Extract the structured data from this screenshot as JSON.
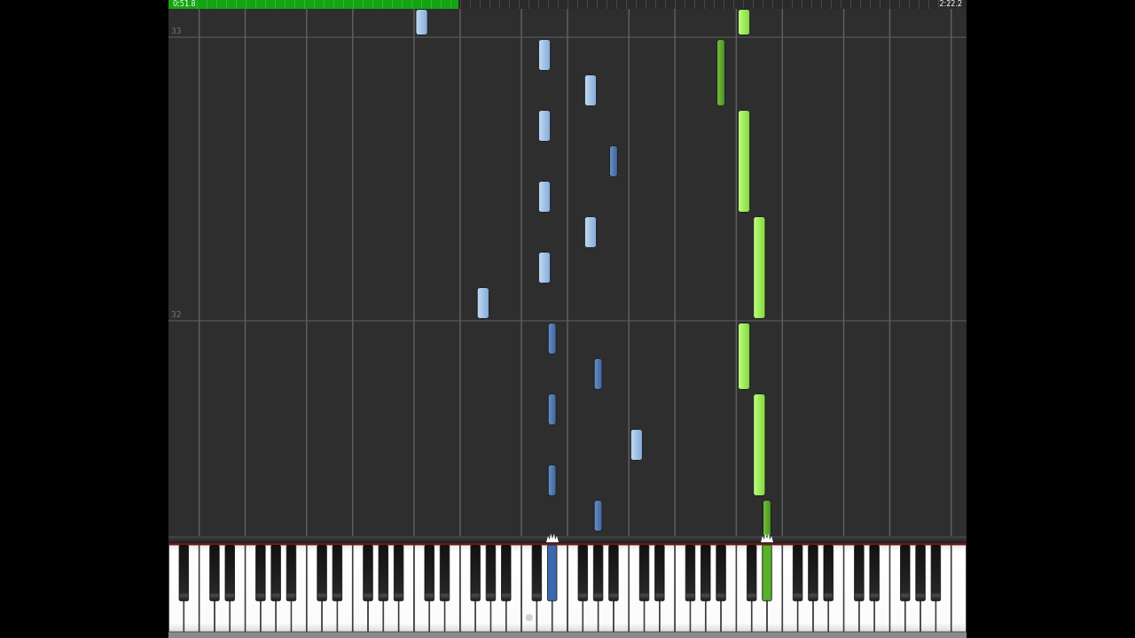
{
  "progress": {
    "elapsed": "0:51.8",
    "total": "2:22.2",
    "level": 0.363
  },
  "measures": [
    {
      "number": "33"
    },
    {
      "number": "32"
    }
  ],
  "keyboard": {
    "keys": [
      {
        "pressed": false
      },
      {
        "pressed": false
      },
      {
        "pressed": false
      },
      {
        "pressed": false
      },
      {
        "pressed": false
      },
      {
        "pressed": false
      },
      {
        "pressed": false
      },
      {
        "pressed": false
      },
      {
        "pressed": false
      },
      {
        "pressed": false
      },
      {
        "pressed": false
      },
      {
        "pressed": false
      },
      {
        "pressed": false
      },
      {
        "pressed": false
      },
      {
        "pressed": false
      },
      {
        "pressed": false
      },
      {
        "pressed": false
      },
      {
        "pressed": false
      },
      {
        "pressed": false
      },
      {
        "pressed": false
      },
      {
        "pressed": false
      },
      {
        "pressed": false
      },
      {
        "pressed": false
      },
      {
        "pressed": false
      },
      {
        "pressed": false
      },
      {
        "pressed": false
      },
      {
        "pressed": false
      },
      {
        "pressed": false
      },
      {
        "pressed": false
      },
      {
        "pressed": false
      },
      {
        "pressed": false
      },
      {
        "pressed": false
      },
      {
        "pressed": false
      },
      {
        "pressed": false
      },
      {
        "pressed": false
      },
      {
        "pressed": false
      },
      {
        "pressed": false
      },
      {
        "pressed": false
      },
      {
        "pressed": false
      },
      {
        "pressed": false
      },
      {
        "pressed": false
      },
      {
        "pressed": false
      },
      {
        "pressed": true,
        "color": "#3a6aad"
      },
      {
        "pressed": false
      },
      {
        "pressed": false
      },
      {
        "pressed": false
      },
      {
        "pressed": false
      },
      {
        "pressed": false
      },
      {
        "pressed": false
      },
      {
        "pressed": false
      },
      {
        "pressed": false
      },
      {
        "pressed": false
      },
      {
        "pressed": false
      },
      {
        "pressed": false
      },
      {
        "pressed": false
      },
      {
        "pressed": false
      },
      {
        "pressed": false
      },
      {
        "pressed": false
      },
      {
        "pressed": false
      },
      {
        "pressed": false
      },
      {
        "pressed": false
      },
      {
        "pressed": false
      },
      {
        "pressed": false
      },
      {
        "pressed": false
      },
      {
        "pressed": false
      },
      {
        "pressed": false
      },
      {
        "pressed": true,
        "color": "#58b02a"
      },
      {
        "pressed": false
      },
      {
        "pressed": false
      },
      {
        "pressed": false
      },
      {
        "pressed": false
      },
      {
        "pressed": false
      },
      {
        "pressed": false
      },
      {
        "pressed": false
      },
      {
        "pressed": false
      },
      {
        "pressed": false
      },
      {
        "pressed": false
      },
      {
        "pressed": false
      },
      {
        "pressed": false
      },
      {
        "pressed": false
      },
      {
        "pressed": false
      },
      {
        "pressed": false
      },
      {
        "pressed": false
      },
      {
        "pressed": false
      },
      {
        "pressed": false
      },
      {
        "pressed": false
      },
      {
        "pressed": false
      },
      {
        "pressed": false
      }
    ]
  }
}
